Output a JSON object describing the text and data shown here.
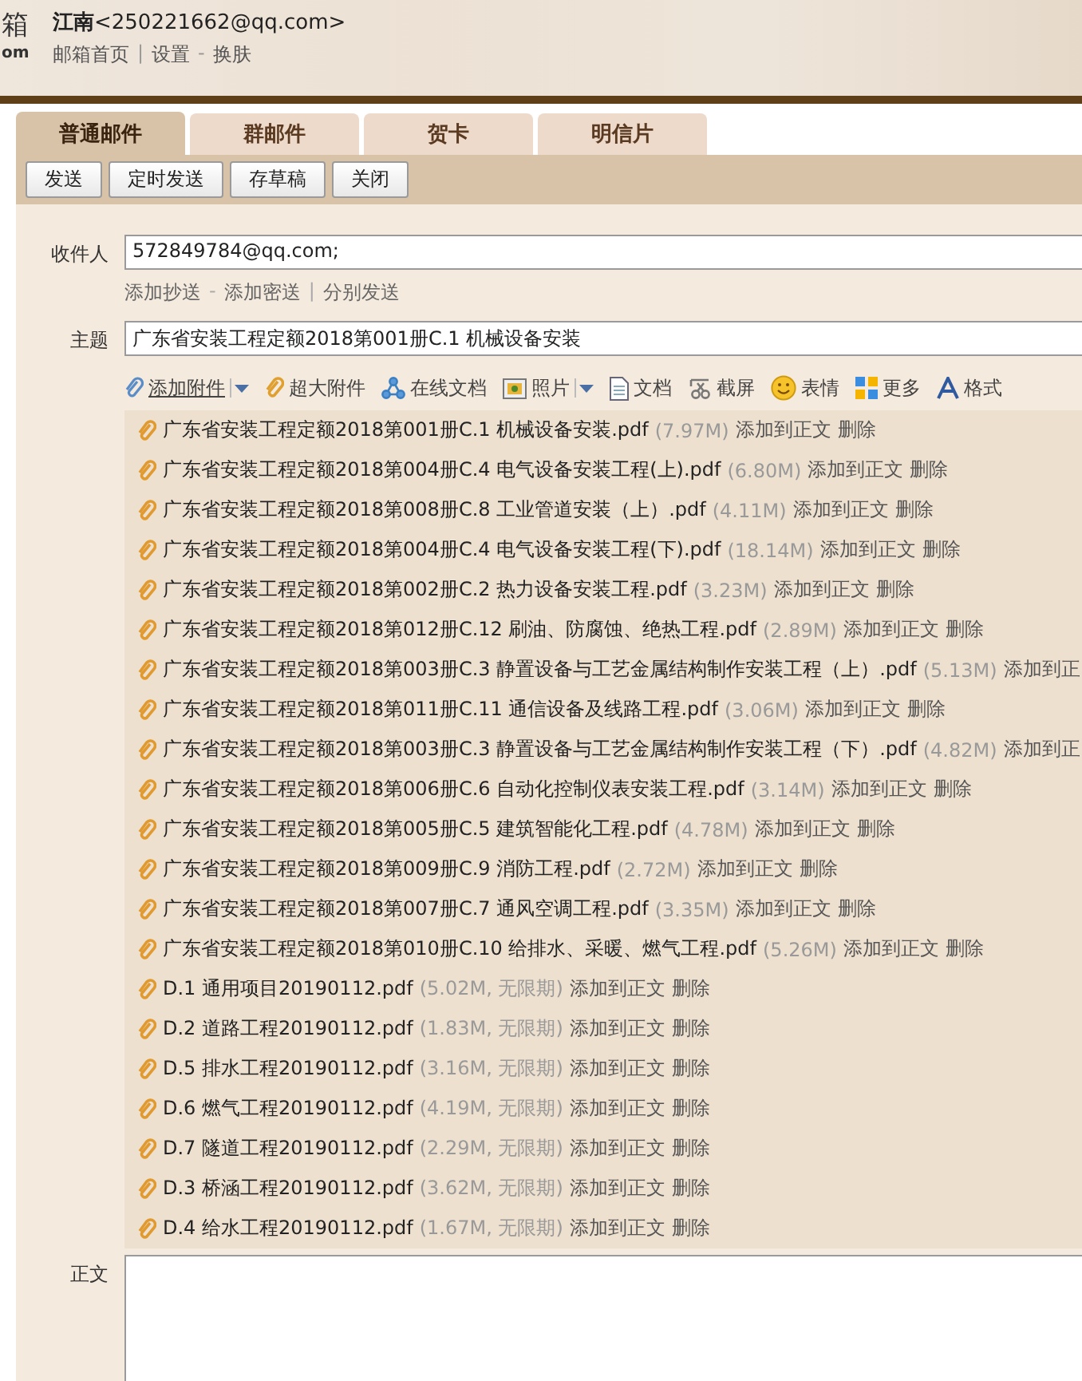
{
  "logo": {
    "char": "箱",
    "domain": "om"
  },
  "account": {
    "name": "江南",
    "email": "<250221662@qq.com>",
    "nav": [
      {
        "kind": "link",
        "text": "邮箱首页"
      },
      {
        "kind": "sep",
        "text": "|"
      },
      {
        "kind": "link",
        "text": "设置"
      },
      {
        "kind": "sep",
        "text": "-"
      },
      {
        "kind": "link",
        "text": "换肤"
      }
    ]
  },
  "tabs": [
    {
      "label": "普通邮件",
      "selected": true
    },
    {
      "label": "群邮件",
      "selected": false
    },
    {
      "label": "贺卡",
      "selected": false
    },
    {
      "label": "明信片",
      "selected": false
    }
  ],
  "buttons": [
    "发送",
    "定时发送",
    "存草稿",
    "关闭"
  ],
  "to": {
    "label": "收件人",
    "value": "572849784@qq.com;"
  },
  "to_links": [
    {
      "kind": "link",
      "text": "添加抄送"
    },
    {
      "kind": "sep",
      "text": "-"
    },
    {
      "kind": "link",
      "text": "添加密送"
    },
    {
      "kind": "sep",
      "text": "|"
    },
    {
      "kind": "link",
      "text": "分别发送"
    }
  ],
  "subject": {
    "label": "主题",
    "value": "广东省安装工程定额2018第001册C.1 机械设备安装"
  },
  "tools": [
    {
      "label": "添加附件",
      "dropdown": true,
      "underline": true
    },
    {
      "label": "超大附件",
      "dropdown": false,
      "underline": false
    },
    {
      "label": "在线文档",
      "dropdown": false,
      "underline": false
    },
    {
      "label": "照片",
      "dropdown": true,
      "underline": false
    },
    {
      "label": "文档",
      "dropdown": false,
      "underline": false
    },
    {
      "label": "截屏",
      "dropdown": false,
      "underline": false
    },
    {
      "label": "表情",
      "dropdown": false,
      "underline": false
    },
    {
      "label": "更多",
      "dropdown": false,
      "underline": false
    },
    {
      "label": "格式",
      "dropdown": false,
      "underline": false
    }
  ],
  "attachments": [
    {
      "name": "广东省安装工程定额2018第001册C.1 机械设备安装.pdf",
      "size": "(7.97M)",
      "actions": [
        "添加到正文",
        "删除"
      ]
    },
    {
      "name": "广东省安装工程定额2018第004册C.4 电气设备安装工程(上).pdf",
      "size": "(6.80M)",
      "actions": [
        "添加到正文",
        "删除"
      ]
    },
    {
      "name": "广东省安装工程定额2018第008册C.8 工业管道安装（上）.pdf",
      "size": "(4.11M)",
      "actions": [
        "添加到正文",
        "删除"
      ]
    },
    {
      "name": "广东省安装工程定额2018第004册C.4 电气设备安装工程(下).pdf",
      "size": "(18.14M)",
      "actions": [
        "添加到正文",
        "删除"
      ]
    },
    {
      "name": "广东省安装工程定额2018第002册C.2 热力设备安装工程.pdf",
      "size": "(3.23M)",
      "actions": [
        "添加到正文",
        "删除"
      ]
    },
    {
      "name": "广东省安装工程定额2018第012册C.12 刷油、防腐蚀、绝热工程.pdf",
      "size": "(2.89M)",
      "actions": [
        "添加到正文",
        "删除"
      ]
    },
    {
      "name": "广东省安装工程定额2018第003册C.3 静置设备与工艺金属结构制作安装工程（上）.pdf",
      "size": "(5.13M)",
      "actions": [
        "添加到正"
      ]
    },
    {
      "name": "广东省安装工程定额2018第011册C.11 通信设备及线路工程.pdf",
      "size": "(3.06M)",
      "actions": [
        "添加到正文",
        "删除"
      ]
    },
    {
      "name": "广东省安装工程定额2018第003册C.3 静置设备与工艺金属结构制作安装工程（下）.pdf",
      "size": "(4.82M)",
      "actions": [
        "添加到正"
      ]
    },
    {
      "name": "广东省安装工程定额2018第006册C.6 自动化控制仪表安装工程.pdf",
      "size": "(3.14M)",
      "actions": [
        "添加到正文",
        "删除"
      ]
    },
    {
      "name": "广东省安装工程定额2018第005册C.5 建筑智能化工程.pdf",
      "size": "(4.78M)",
      "actions": [
        "添加到正文",
        "删除"
      ]
    },
    {
      "name": "广东省安装工程定额2018第009册C.9 消防工程.pdf",
      "size": "(2.72M)",
      "actions": [
        "添加到正文",
        "删除"
      ]
    },
    {
      "name": "广东省安装工程定额2018第007册C.7 通风空调工程.pdf",
      "size": "(3.35M)",
      "actions": [
        "添加到正文",
        "删除"
      ]
    },
    {
      "name": "广东省安装工程定额2018第010册C.10 给排水、采暖、燃气工程.pdf",
      "size": "(5.26M)",
      "actions": [
        "添加到正文",
        "删除"
      ]
    },
    {
      "name": "D.1 通用项目20190112.pdf",
      "size": "(5.02M, 无限期)",
      "actions": [
        "添加到正文",
        "删除"
      ]
    },
    {
      "name": "D.2 道路工程20190112.pdf",
      "size": "(1.83M, 无限期)",
      "actions": [
        "添加到正文",
        "删除"
      ]
    },
    {
      "name": "D.5 排水工程20190112.pdf",
      "size": "(3.16M, 无限期)",
      "actions": [
        "添加到正文",
        "删除"
      ]
    },
    {
      "name": "D.6 燃气工程20190112.pdf",
      "size": "(4.19M, 无限期)",
      "actions": [
        "添加到正文",
        "删除"
      ]
    },
    {
      "name": "D.7 隧道工程20190112.pdf",
      "size": "(2.29M, 无限期)",
      "actions": [
        "添加到正文",
        "删除"
      ]
    },
    {
      "name": "D.3 桥涵工程20190112.pdf",
      "size": "(3.62M, 无限期)",
      "actions": [
        "添加到正文",
        "删除"
      ]
    },
    {
      "name": "D.4 给水工程20190112.pdf",
      "size": "(1.67M, 无限期)",
      "actions": [
        "添加到正文",
        "删除"
      ]
    }
  ],
  "body": {
    "label": "正文"
  }
}
